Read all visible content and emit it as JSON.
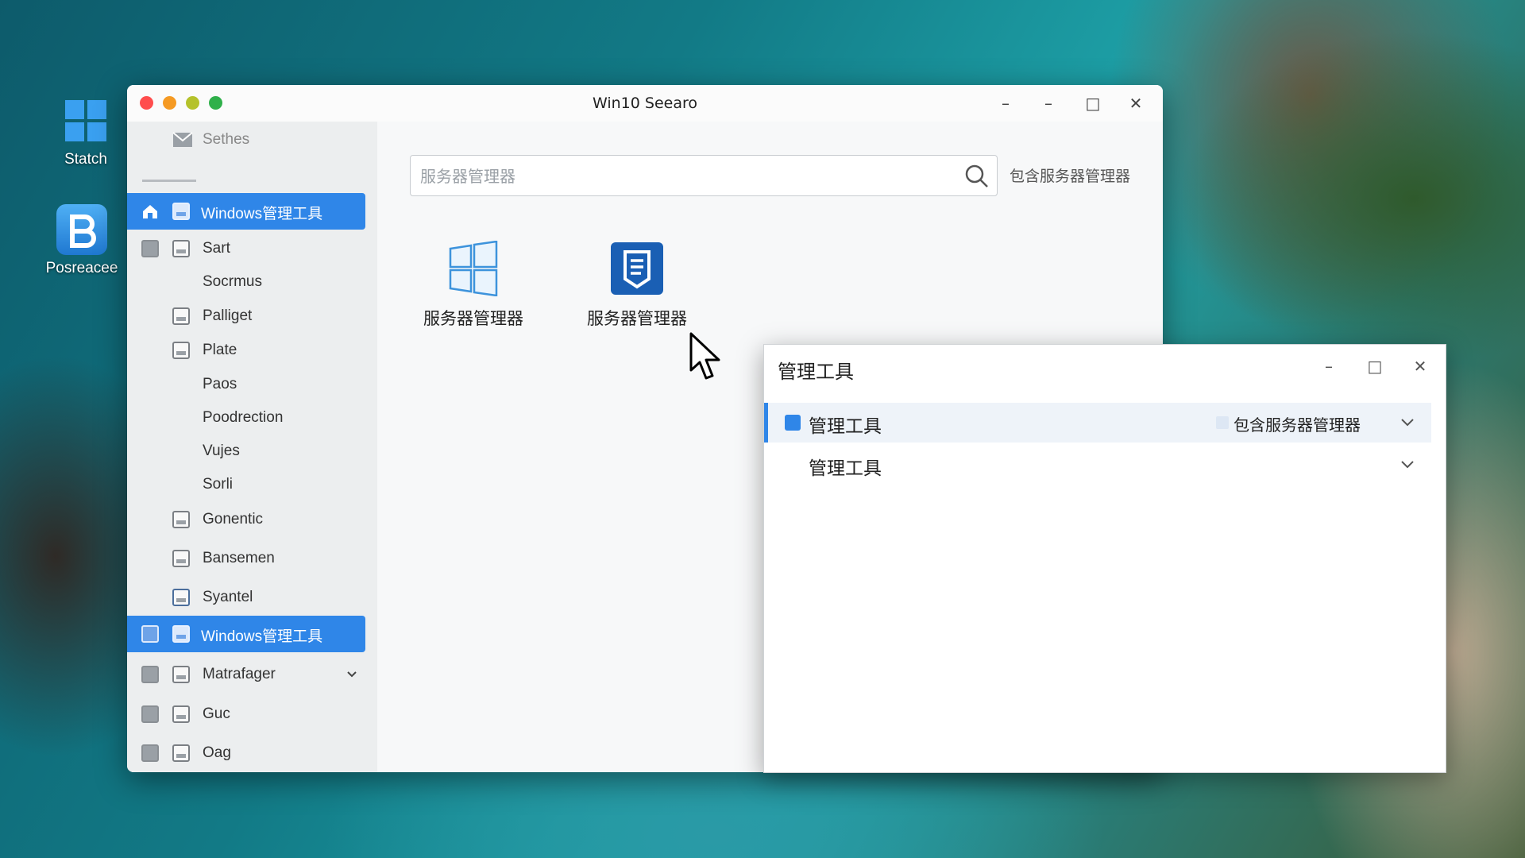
{
  "desktop": {
    "icons": [
      {
        "label": "Statch",
        "icon": "windows-logo-icon"
      },
      {
        "label": "Posreacee",
        "icon": "app-b-icon"
      }
    ]
  },
  "main_window": {
    "title": "Win10 Seearo",
    "controls": [
      "minimize",
      "minimize",
      "maximize",
      "close"
    ],
    "sidebar": {
      "header": "Sethes",
      "items": [
        {
          "label": "Windows管理工具",
          "active": true
        },
        {
          "label": "Sart"
        },
        {
          "label": "Socrmus"
        },
        {
          "label": "Palliget"
        },
        {
          "label": "Plate"
        },
        {
          "label": "Paos"
        },
        {
          "label": "Poodrection"
        },
        {
          "label": "Vujes"
        },
        {
          "label": "Sorli"
        },
        {
          "label": "Gonentic"
        },
        {
          "label": "Bansemen"
        },
        {
          "label": "Syantel"
        },
        {
          "label": "Windows管理工具",
          "active": true
        },
        {
          "label": "Matrafager"
        },
        {
          "label": "Guc"
        },
        {
          "label": "Oag"
        }
      ]
    },
    "search": {
      "placeholder": "服务器管理器",
      "value": ""
    },
    "search_link": "包含服务器管理器",
    "apps": [
      {
        "label": "服务器管理器",
        "icon": "windows-logo-icon"
      },
      {
        "label": "服务器管理器",
        "icon": "server-manager-icon"
      }
    ]
  },
  "dialog": {
    "title": "管理工具",
    "rows": [
      {
        "label": "管理工具",
        "tag": "包含服务器管理器",
        "selected": true
      },
      {
        "label": "管理工具"
      }
    ]
  },
  "colors": {
    "accent": "#2f86e8",
    "close": "#ff5f57",
    "minimize": "#febc2e",
    "zoom": "#28c840"
  }
}
